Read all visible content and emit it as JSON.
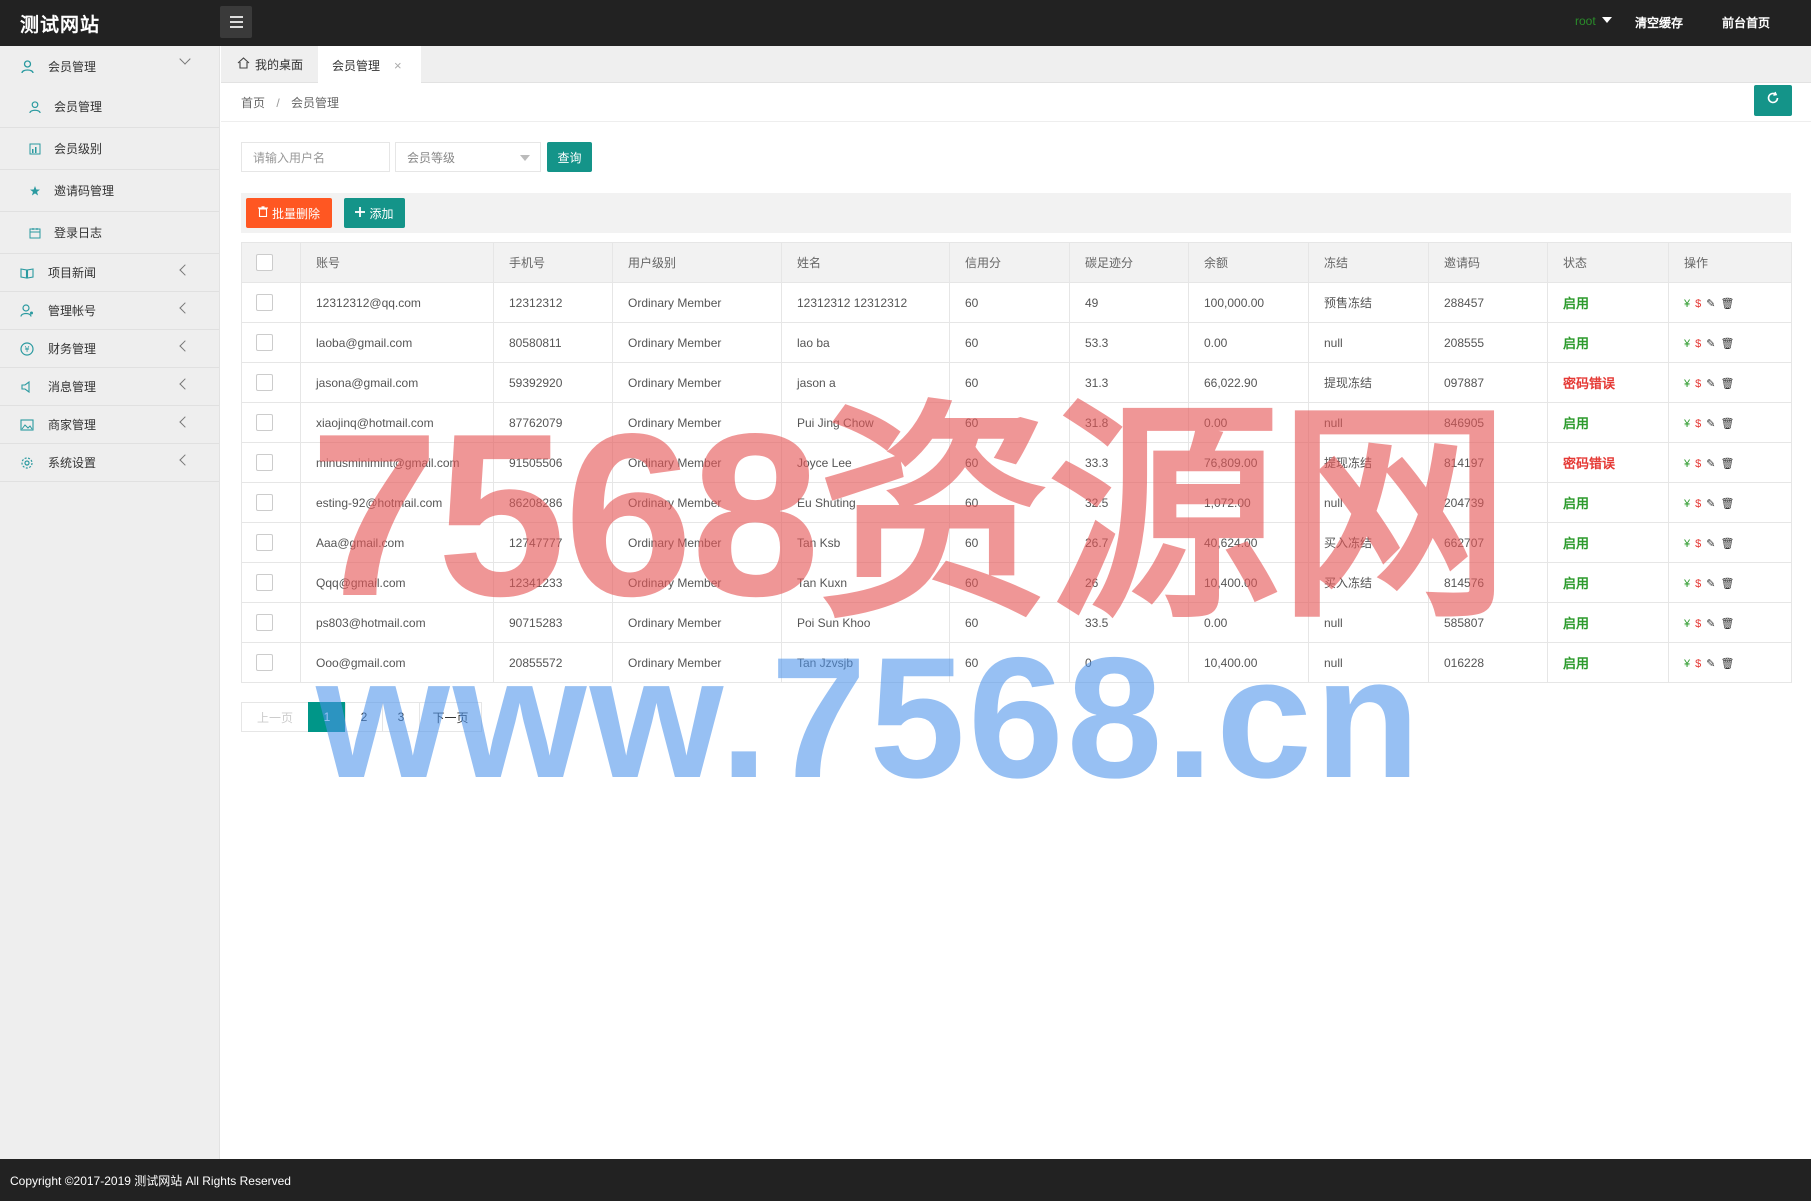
{
  "header": {
    "logo": "测试网站",
    "user": "root",
    "clear_cache": "清空缓存",
    "front_home": "前台首页"
  },
  "sidebar": {
    "items": [
      {
        "label": "会员管理",
        "icon": "user-icon",
        "type": "top",
        "expanded": true
      },
      {
        "label": "会员管理",
        "icon": "user-icon",
        "type": "sub"
      },
      {
        "label": "会员级别",
        "icon": "chart-icon",
        "type": "sub"
      },
      {
        "label": "邀请码管理",
        "icon": "star-icon",
        "type": "sub"
      },
      {
        "label": "登录日志",
        "icon": "calendar-icon",
        "type": "sub"
      },
      {
        "label": "项目新闻",
        "icon": "book-icon",
        "type": "top"
      },
      {
        "label": "管理帐号",
        "icon": "admin-icon",
        "type": "top"
      },
      {
        "label": "财务管理",
        "icon": "yen-icon",
        "type": "top"
      },
      {
        "label": "消息管理",
        "icon": "speaker-icon",
        "type": "top"
      },
      {
        "label": "商家管理",
        "icon": "image-icon",
        "type": "top"
      },
      {
        "label": "系统设置",
        "icon": "gear-icon",
        "type": "top"
      }
    ]
  },
  "tabs": {
    "home": "我的桌面",
    "active": "会员管理",
    "close": "×"
  },
  "breadcrumb": {
    "home": "首页",
    "sep": "/",
    "current": "会员管理"
  },
  "search": {
    "placeholder": "请输入用户名",
    "level_placeholder": "会员等级",
    "query": "查询"
  },
  "toolbar": {
    "batch_delete": "批量删除",
    "add": "添加"
  },
  "table": {
    "headers": [
      "账号",
      "手机号",
      "用户级别",
      "姓名",
      "信用分",
      "碳足迹分",
      "余额",
      "冻结",
      "邀请码",
      "状态",
      "操作"
    ],
    "rows": [
      {
        "account": "12312312@qq.com",
        "phone": "12312312",
        "level": "Ordinary Member",
        "name": "12312312 12312312",
        "credit": "60",
        "carbon": "49",
        "balance": "100,000.00",
        "frozen": "预售冻结",
        "invite": "288457",
        "status": "启用",
        "status_type": "on"
      },
      {
        "account": "laoba@gmail.com",
        "phone": "80580811",
        "level": "Ordinary Member",
        "name": "lao ba",
        "credit": "60",
        "carbon": "53.3",
        "balance": "0.00",
        "frozen": "null",
        "invite": "208555",
        "status": "启用",
        "status_type": "on"
      },
      {
        "account": "jasona@gmail.com",
        "phone": "59392920",
        "level": "Ordinary Member",
        "name": "jason a",
        "credit": "60",
        "carbon": "31.3",
        "balance": "66,022.90",
        "frozen": "提现冻结",
        "invite": "097887",
        "status": "密码错误",
        "status_type": "err"
      },
      {
        "account": "xiaojinq@hotmail.com",
        "phone": "87762079",
        "level": "Ordinary Member",
        "name": "Pui Jing Chow",
        "credit": "60",
        "carbon": "31.8",
        "balance": "0.00",
        "frozen": "null",
        "invite": "846905",
        "status": "启用",
        "status_type": "on"
      },
      {
        "account": "minusminimint@gmail.com",
        "phone": "91505506",
        "level": "Ordinary Member",
        "name": "Joyce Lee",
        "credit": "60",
        "carbon": "33.3",
        "balance": "76,809.00",
        "frozen": "提现冻结",
        "invite": "814197",
        "status": "密码错误",
        "status_type": "err"
      },
      {
        "account": "esting-92@hotmail.com",
        "phone": "86208286",
        "level": "Ordinary Member",
        "name": "Eu Shuting",
        "credit": "60",
        "carbon": "32.5",
        "balance": "1,072.00",
        "frozen": "null",
        "invite": "204739",
        "status": "启用",
        "status_type": "on"
      },
      {
        "account": "Aaa@gmail.com",
        "phone": "12747777",
        "level": "Ordinary Member",
        "name": "Tan Ksb",
        "credit": "60",
        "carbon": "26.7",
        "balance": "40,624.00",
        "frozen": "买入冻结",
        "invite": "662707",
        "status": "启用",
        "status_type": "on"
      },
      {
        "account": "Qqq@gmail.com",
        "phone": "12341233",
        "level": "Ordinary Member",
        "name": "Tan Kuxn",
        "credit": "60",
        "carbon": "26",
        "balance": "10,400.00",
        "frozen": "买入冻结",
        "invite": "814576",
        "status": "启用",
        "status_type": "on"
      },
      {
        "account": "ps803@hotmail.com",
        "phone": "90715283",
        "level": "Ordinary Member",
        "name": "Poi Sun Khoo",
        "credit": "60",
        "carbon": "33.5",
        "balance": "0.00",
        "frozen": "null",
        "invite": "585807",
        "status": "启用",
        "status_type": "on"
      },
      {
        "account": "Ooo@gmail.com",
        "phone": "20855572",
        "level": "Ordinary Member",
        "name": "Tan Jzvsjb",
        "credit": "60",
        "carbon": "0",
        "balance": "10,400.00",
        "frozen": "null",
        "invite": "016228",
        "status": "启用",
        "status_type": "on"
      }
    ],
    "ops": [
      "¥",
      "$",
      "✎",
      "🗑"
    ]
  },
  "pager": {
    "prev": "上一页",
    "pages": [
      "1",
      "2",
      "3"
    ],
    "current": "1",
    "next": "下一页"
  },
  "footer": {
    "copyright": "Copyright ©2017-2019 测试网站 All Rights Reserved"
  },
  "watermark": {
    "line1": "7568资源网",
    "line2": "www.7568.cn"
  },
  "colors": {
    "primary": "#149489",
    "danger": "#ff5722",
    "header_bg": "#222222",
    "status_on": "#2b9a2b",
    "status_err": "#e53935"
  }
}
